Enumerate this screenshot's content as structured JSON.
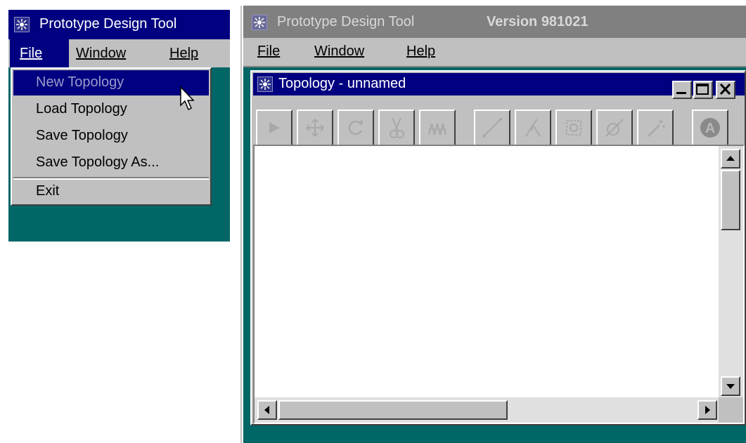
{
  "left_window": {
    "title": "Prototype Design Tool",
    "menu": {
      "file": "File",
      "window": "Window",
      "help": "Help"
    },
    "file_menu": {
      "items": [
        "New Topology",
        "Load Topology",
        "Save Topology",
        "Save Topology As..."
      ],
      "exit": "Exit"
    }
  },
  "right_window": {
    "title": "Prototype Design Tool",
    "version": "Version 981021",
    "menu": {
      "file": "File",
      "window": "Window",
      "help": "Help"
    },
    "inner": {
      "title": "Topology - unnamed",
      "toolbar": [
        "select-tool",
        "move-tool",
        "rotate-tool",
        "cut-tool",
        "group-tool",
        "line-tool",
        "branch-tool",
        "node-tool",
        "link-tool",
        "wand-tool",
        "text-tool"
      ]
    }
  },
  "colors": {
    "desktop": "#006666",
    "title_active": "#000080",
    "title_inactive": "#808080",
    "face": "#c0c0c0"
  }
}
